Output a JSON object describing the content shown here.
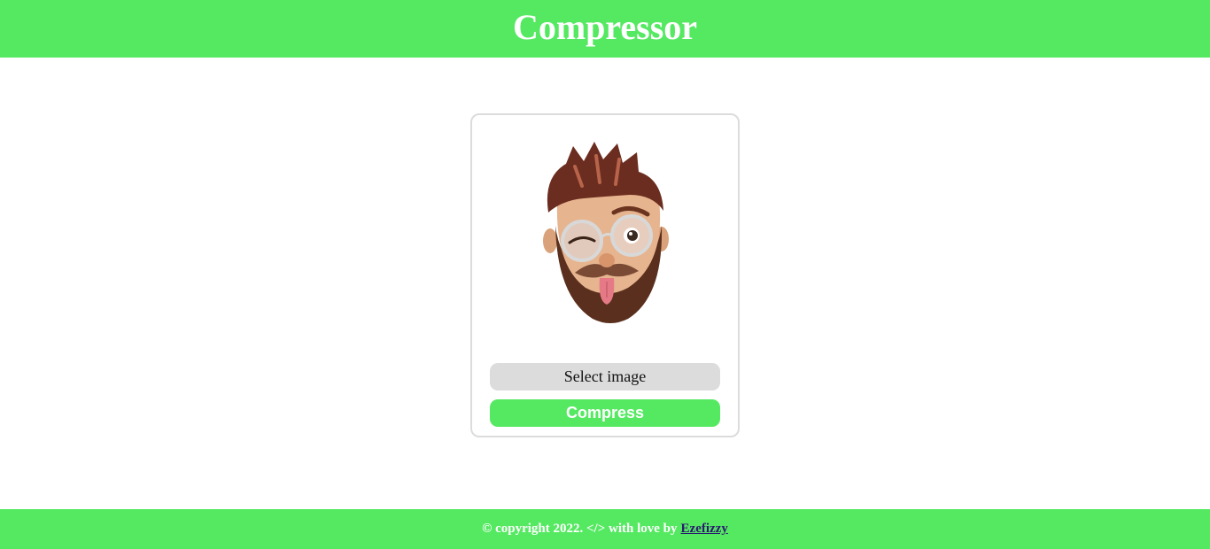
{
  "header": {
    "title": "Compressor"
  },
  "card": {
    "preview_alt": "memoji-avatar",
    "select_label": "Select image",
    "compress_label": "Compress"
  },
  "footer": {
    "text": "© copyright 2022. </> with love by",
    "link_label": "Ezefizzy"
  },
  "colors": {
    "brand_green": "#55e962",
    "select_bg": "#dcdcdc",
    "card_border": "#dcdcdc",
    "link_color": "#2a1a6e"
  }
}
